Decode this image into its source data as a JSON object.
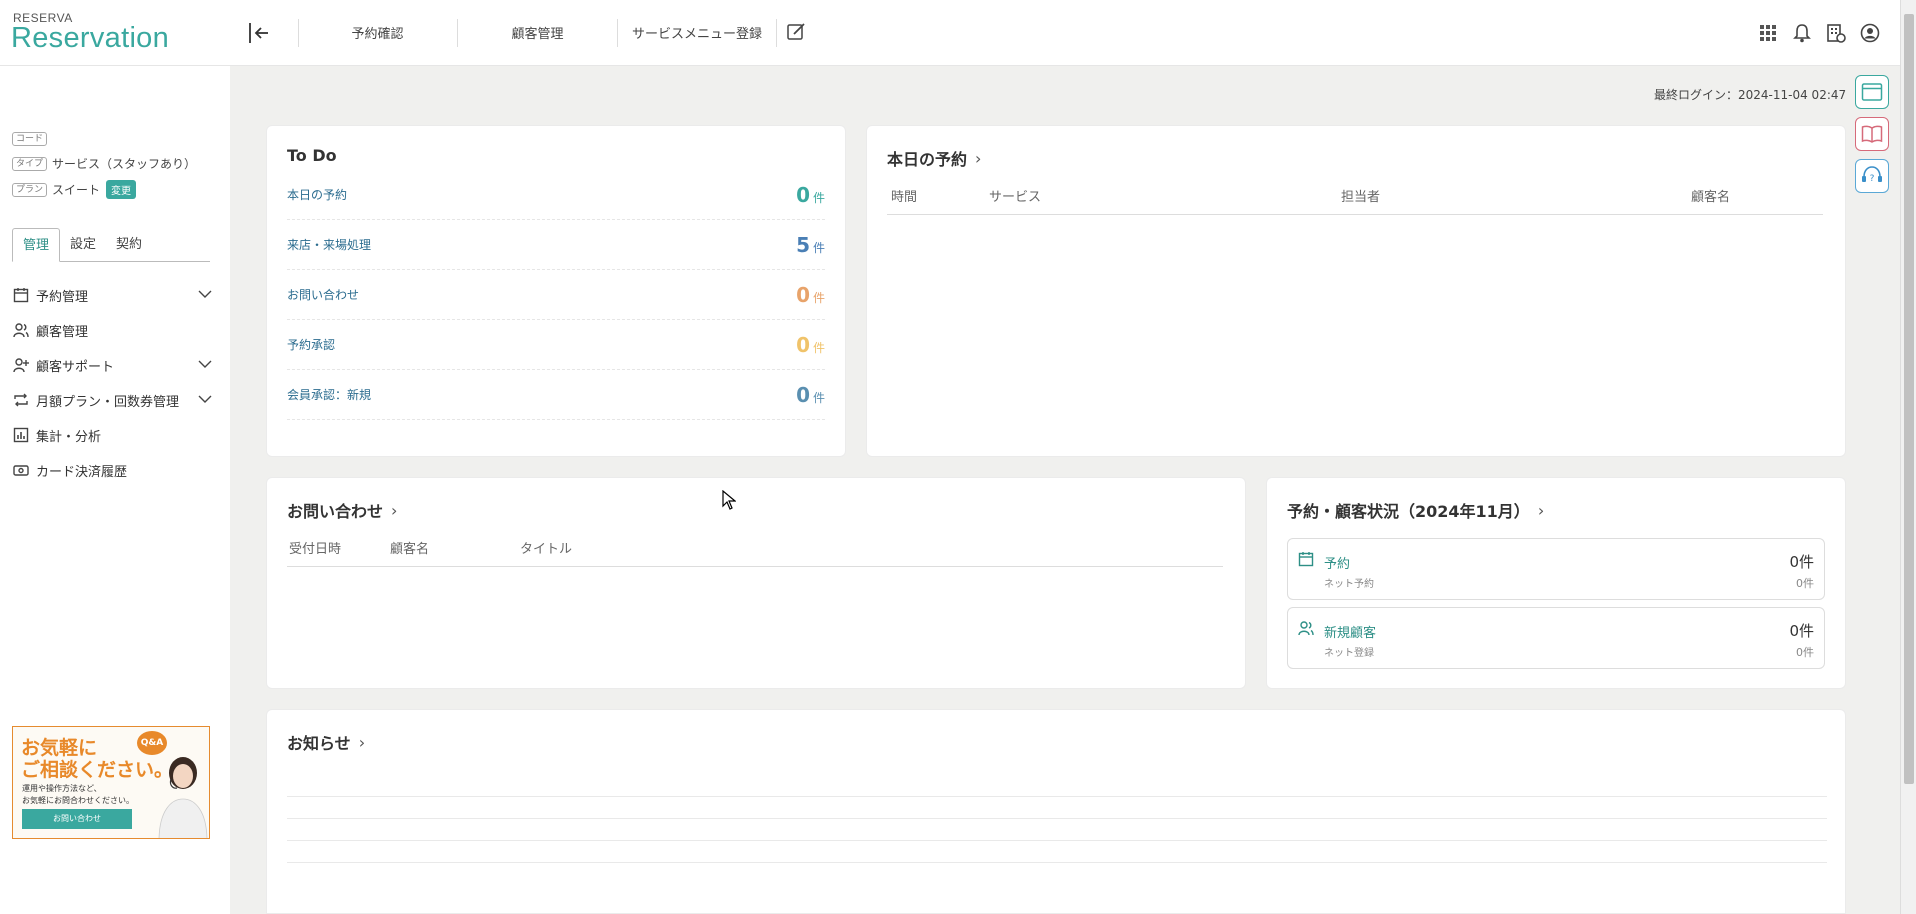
{
  "brand": {
    "small": "RESERVA",
    "big": "Reservation"
  },
  "topnav": {
    "items": [
      "予約確認",
      "顧客管理",
      "サービスメニュー登録"
    ],
    "icons": [
      "grid-icon",
      "bell-icon",
      "store-settings-icon",
      "account-icon"
    ]
  },
  "sidebar": {
    "code_tag": "コード",
    "type_tag": "タイプ",
    "type_value": "サービス（スタッフあり）",
    "plan_tag": "プラン",
    "plan_value": "スイート",
    "change_label": "変更",
    "tabs": [
      "管理",
      "設定",
      "契約"
    ],
    "menu": [
      {
        "label": "予約管理",
        "icon": "calendar-icon",
        "expandable": true
      },
      {
        "label": "顧客管理",
        "icon": "users-icon",
        "expandable": false
      },
      {
        "label": "顧客サポート",
        "icon": "user-support-icon",
        "expandable": true
      },
      {
        "label": "月額プラン・回数券管理",
        "icon": "repeat-icon",
        "expandable": true
      },
      {
        "label": "集計・分析",
        "icon": "chart-icon",
        "expandable": false
      },
      {
        "label": "カード決済履歴",
        "icon": "card-icon",
        "expandable": false
      }
    ],
    "banner": {
      "title1": "お気軽に",
      "title2": "ご相談ください。",
      "sub1": "運用や操作方法など、",
      "sub2": "お気軽にお問合わせください。",
      "button": "お問い合わせ",
      "qa": "Q&A"
    }
  },
  "header": {
    "last_login": "最終ログイン：2024-11-04 02:47"
  },
  "todo": {
    "title": "To Do",
    "rows": [
      {
        "label": "本日の予約",
        "count": "0",
        "unit": "件",
        "color": "#3aa89f"
      },
      {
        "label": "来店・来場処理",
        "count": "5",
        "unit": "件",
        "color": "#4a7fb5"
      },
      {
        "label": "お問い合わせ",
        "count": "0",
        "unit": "件",
        "color": "#e8a36a"
      },
      {
        "label": "予約承認",
        "count": "0",
        "unit": "件",
        "color": "#f0c36a"
      },
      {
        "label": "会員承認：新規",
        "count": "0",
        "unit": "件",
        "color": "#5a8fb0"
      }
    ]
  },
  "today": {
    "title": "本日の予約",
    "headers": [
      "時間",
      "サービス",
      "担当者",
      "顧客名"
    ]
  },
  "inquiry": {
    "title": "お問い合わせ",
    "headers": [
      "受付日時",
      "顧客名",
      "タイトル"
    ]
  },
  "status": {
    "title": "予約・顧客状況（2024年11月）",
    "boxes": [
      {
        "label": "予約",
        "sub": "ネット予約",
        "value": "0件",
        "subvalue": "0件",
        "icon": "calendar-icon"
      },
      {
        "label": "新規顧客",
        "sub": "ネット登録",
        "value": "0件",
        "subvalue": "0件",
        "icon": "users-icon"
      }
    ]
  },
  "news": {
    "title": "お知らせ"
  }
}
